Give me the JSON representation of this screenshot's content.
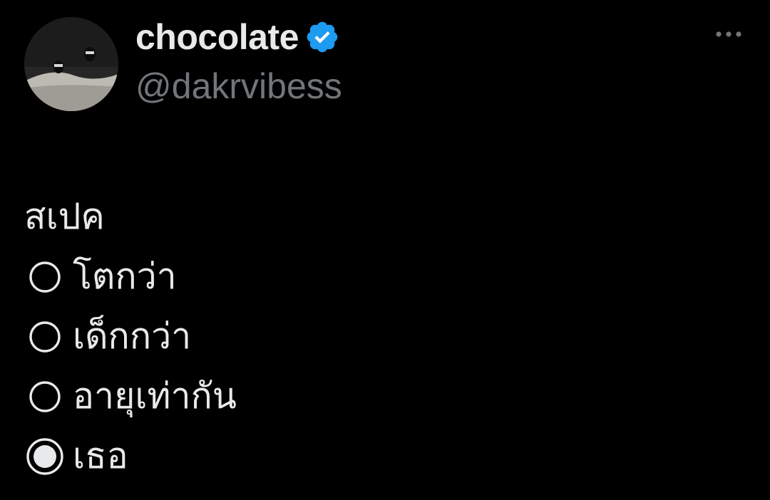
{
  "author": {
    "display_name": "chocolate",
    "handle": "@dakrvibess",
    "verified": true,
    "verified_color": "#1d9bf0",
    "avatar_icon": "avatar-photo",
    "more_icon": "more-horizontal-icon"
  },
  "tweet": {
    "heading": "สเปค",
    "options": [
      {
        "label": "โตกว่า",
        "selected": false
      },
      {
        "label": "เด็กกว่า",
        "selected": false
      },
      {
        "label": "อายุเท่ากัน",
        "selected": false
      },
      {
        "label": "เธอ",
        "selected": true
      }
    ]
  },
  "theme": {
    "background": "#000000",
    "text": "#e7e9ea",
    "secondary_text": "#71767b"
  }
}
